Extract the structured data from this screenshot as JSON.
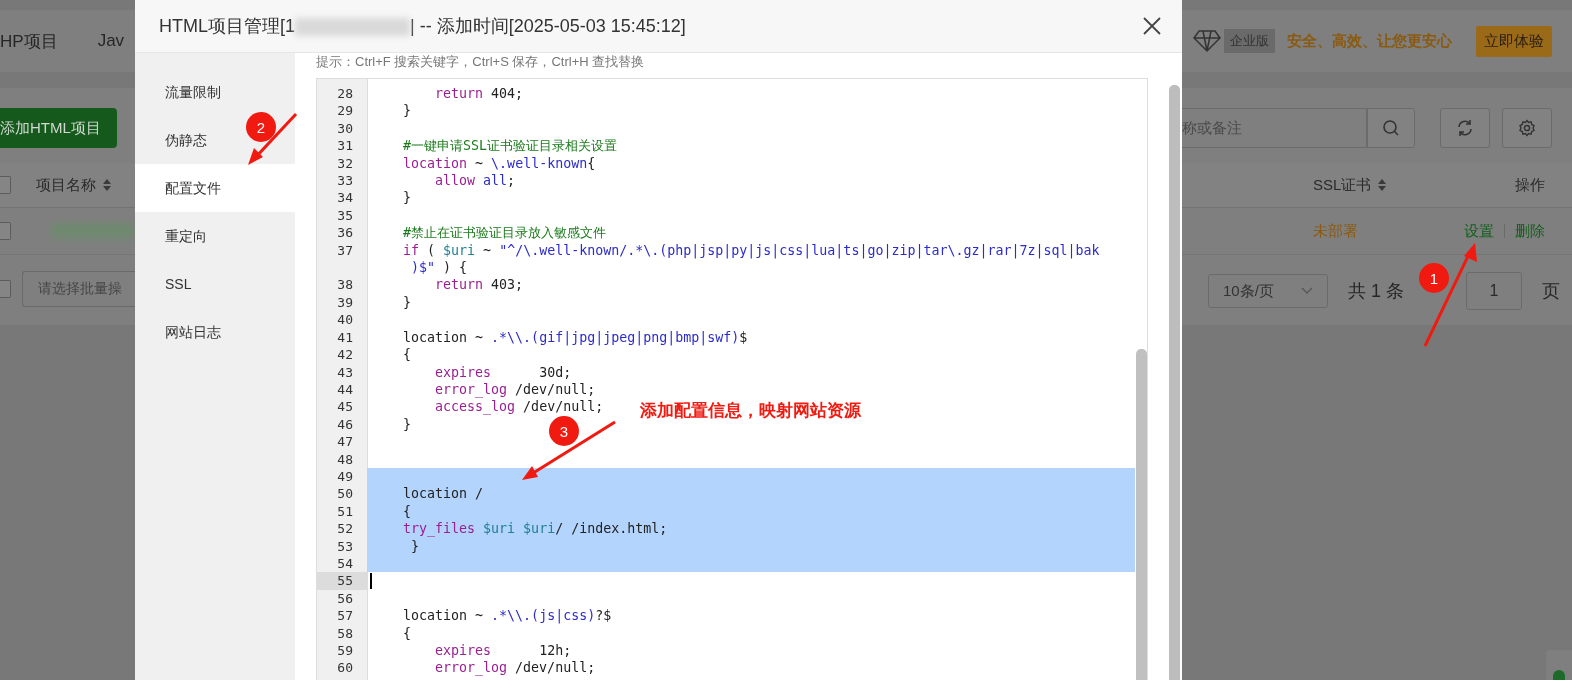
{
  "background_page": {
    "nav": [
      "HP项目",
      "Jav"
    ],
    "add_button": "添加HTML项目",
    "banner": {
      "tag": "企业版",
      "slogan": "安全、高效、让您更安心",
      "button": "立即体验"
    },
    "search": {
      "placeholder": "称或备注"
    },
    "table": {
      "select_all": {
        "checked": false
      },
      "columns": [
        "项目名称",
        "SSL证书",
        "操作"
      ],
      "row": {
        "checked": false,
        "ssl_status": "未部署",
        "actions": [
          "设置",
          "删除"
        ]
      }
    },
    "batch_select": {
      "checked": false,
      "placeholder": "请选择批量操"
    },
    "pagination": {
      "page_size": "10条/页",
      "total": "共 1 条",
      "page": "1",
      "page_unit": "页"
    }
  },
  "modal": {
    "title_prefix": "HTML项目管理[1",
    "title_suffix": "| -- 添加时间[2025-05-03 15:45:12]",
    "sidebar": [
      {
        "label": "流量限制",
        "selected": false
      },
      {
        "label": "伪静态",
        "selected": false
      },
      {
        "label": "配置文件",
        "selected": true
      },
      {
        "label": "重定向",
        "selected": false
      },
      {
        "label": "SSL",
        "selected": false
      },
      {
        "label": "网站日志",
        "selected": false
      }
    ],
    "hint": "提示：Ctrl+F 搜索关键字，Ctrl+S 保存，Ctrl+H 查找替换",
    "lines": [
      {
        "no": "28",
        "selected": false,
        "cursor": false,
        "tokens": [
          {
            "t": "        return",
            "kind": "kw"
          },
          {
            "t": " 404;"
          }
        ]
      },
      {
        "no": "29",
        "selected": false,
        "cursor": false,
        "tokens": [
          {
            "t": "    }"
          }
        ]
      },
      {
        "no": "30",
        "selected": false,
        "cursor": false
      },
      {
        "no": "31",
        "selected": false,
        "cursor": false,
        "tokens": [
          {
            "t": "    #一键申请SSL证书验证目录相关设置",
            "kind": "comment"
          }
        ]
      },
      {
        "no": "32",
        "selected": false,
        "cursor": false,
        "tokens": [
          {
            "t": "    location",
            "kind": "kw"
          },
          {
            "t": " ~ "
          },
          {
            "t": "\\.well-known",
            "kind": "atom"
          },
          {
            "t": "{"
          }
        ]
      },
      {
        "no": "33",
        "selected": false,
        "cursor": false,
        "tokens": [
          {
            "t": "        allow",
            "kind": "kw"
          },
          {
            "t": " all",
            "kind": "atom"
          },
          {
            "t": ";"
          }
        ]
      },
      {
        "no": "34",
        "selected": false,
        "cursor": false,
        "tokens": [
          {
            "t": "    }"
          }
        ]
      },
      {
        "no": "35",
        "selected": false,
        "cursor": false
      },
      {
        "no": "36",
        "selected": false,
        "cursor": false,
        "tokens": [
          {
            "t": "    #禁止在证书验证目录放入敏感文件",
            "kind": "comment"
          }
        ]
      },
      {
        "no": "37",
        "selected": false,
        "cursor": false,
        "tokens": [
          {
            "t": "    if",
            "kind": "kw"
          },
          {
            "t": " ( "
          },
          {
            "t": "$uri",
            "kind": "var"
          },
          {
            "t": " ~ "
          },
          {
            "t": "\"^/\\.well-known/.*\\.(php|jsp|py|js|css|lua|ts|go|zip|tar\\.gz|rar|7z|sql|bak",
            "kind": "str"
          }
        ],
        "continuation": [
          {
            "t": "     )$\"",
            "kind": "str"
          },
          {
            "t": " ) {"
          }
        ]
      },
      {
        "no": "38",
        "selected": false,
        "cursor": false,
        "tokens": [
          {
            "t": "        return",
            "kind": "kw"
          },
          {
            "t": " 403;"
          }
        ]
      },
      {
        "no": "39",
        "selected": false,
        "cursor": false,
        "tokens": [
          {
            "t": "    }"
          }
        ]
      },
      {
        "no": "40",
        "selected": false,
        "cursor": false
      },
      {
        "no": "41",
        "selected": false,
        "cursor": false,
        "tokens": [
          {
            "t": "    location ~ "
          },
          {
            "t": ".*\\\\.(gif|jpg|jpeg|png|bmp|swf)",
            "kind": "atom"
          },
          {
            "t": "$"
          }
        ]
      },
      {
        "no": "42",
        "selected": false,
        "cursor": false,
        "tokens": [
          {
            "t": "    {"
          }
        ]
      },
      {
        "no": "43",
        "selected": false,
        "cursor": false,
        "tokens": [
          {
            "t": "        expires",
            "kind": "kw"
          },
          {
            "t": "      30d;"
          }
        ]
      },
      {
        "no": "44",
        "selected": false,
        "cursor": false,
        "tokens": [
          {
            "t": "        error_log",
            "kind": "kw"
          },
          {
            "t": " /dev/null;"
          }
        ]
      },
      {
        "no": "45",
        "selected": false,
        "cursor": false,
        "tokens": [
          {
            "t": "        access_log",
            "kind": "kw"
          },
          {
            "t": " /dev/null;"
          }
        ]
      },
      {
        "no": "46",
        "selected": false,
        "cursor": false,
        "tokens": [
          {
            "t": "    }"
          }
        ]
      },
      {
        "no": "47",
        "selected": false,
        "cursor": false
      },
      {
        "no": "48",
        "selected": false,
        "cursor": false
      },
      {
        "no": "49",
        "selected": true,
        "cursor": false
      },
      {
        "no": "50",
        "selected": true,
        "cursor": false,
        "tokens": [
          {
            "t": "    location /"
          }
        ]
      },
      {
        "no": "51",
        "selected": true,
        "cursor": false,
        "tokens": [
          {
            "t": "    {"
          }
        ]
      },
      {
        "no": "52",
        "selected": true,
        "cursor": false,
        "tokens": [
          {
            "t": "    try_files",
            "kind": "kw"
          },
          {
            "t": " $uri",
            "kind": "var"
          },
          {
            "t": " $uri",
            "kind": "var"
          },
          {
            "t": "/ /index.html;"
          }
        ]
      },
      {
        "no": "53",
        "selected": true,
        "cursor": false,
        "tokens": [
          {
            "t": "     }"
          }
        ]
      },
      {
        "no": "54",
        "selected": true,
        "cursor": false
      },
      {
        "no": "55",
        "selected": false,
        "cursor": true
      },
      {
        "no": "56",
        "selected": false,
        "cursor": false
      },
      {
        "no": "57",
        "selected": false,
        "cursor": false,
        "tokens": [
          {
            "t": "    location ~ "
          },
          {
            "t": ".*\\\\.(js|css)",
            "kind": "atom"
          },
          {
            "t": "?$"
          }
        ]
      },
      {
        "no": "58",
        "selected": false,
        "cursor": false,
        "tokens": [
          {
            "t": "    {"
          }
        ]
      },
      {
        "no": "59",
        "selected": false,
        "cursor": false,
        "tokens": [
          {
            "t": "        expires",
            "kind": "kw"
          },
          {
            "t": "      12h;"
          }
        ]
      },
      {
        "no": "60",
        "selected": false,
        "cursor": false,
        "tokens": [
          {
            "t": "        error_log",
            "kind": "kw"
          },
          {
            "t": " /dev/null;"
          }
        ]
      }
    ]
  },
  "annotations": {
    "badges": [
      "1",
      "2",
      "3"
    ],
    "caption": "添加配置信息，映射网站资源"
  }
}
